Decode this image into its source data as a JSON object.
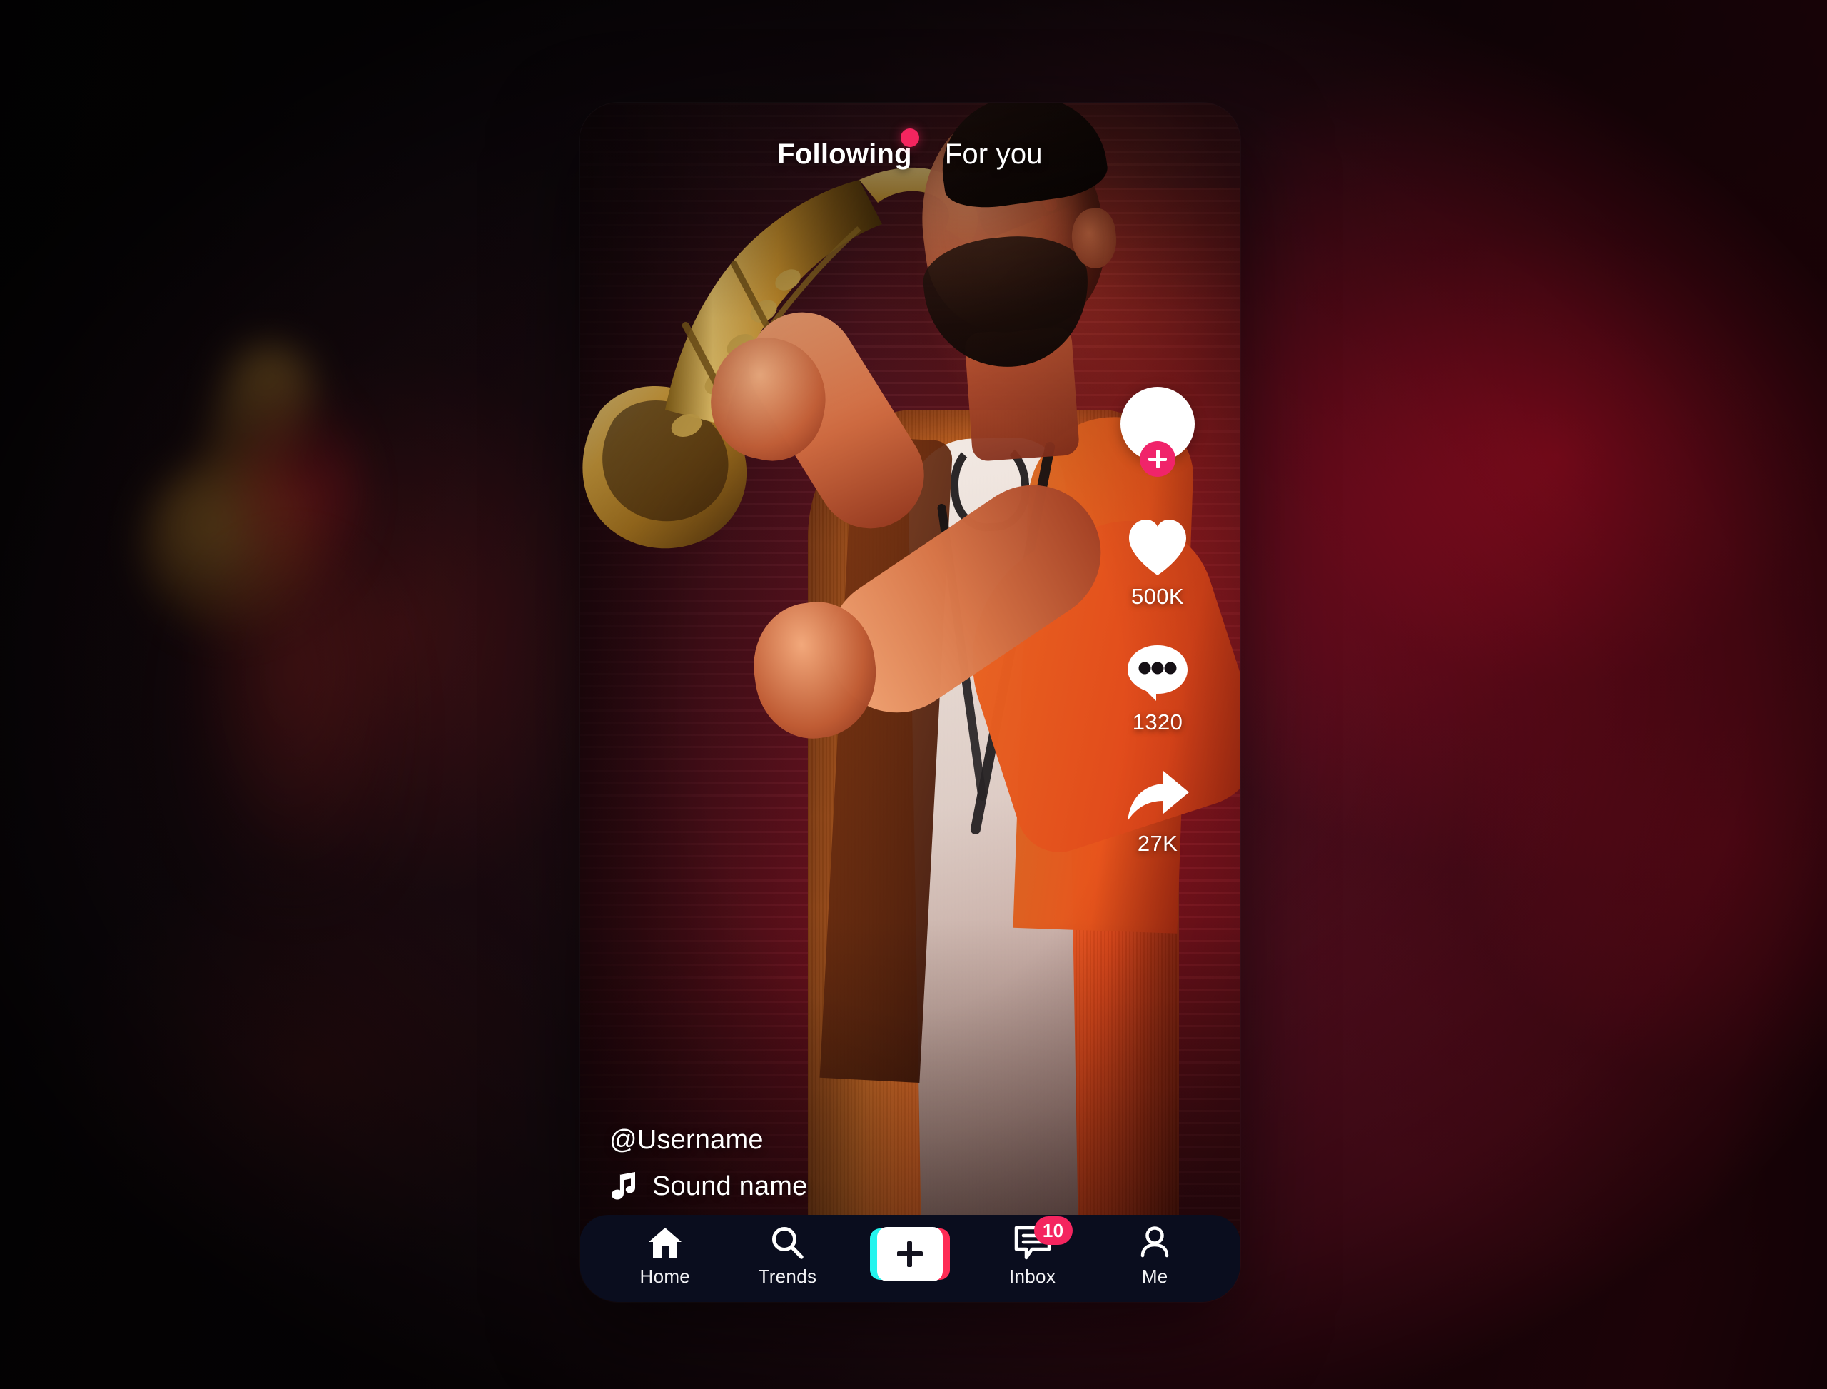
{
  "app": {
    "screen_name": "tiktok-style-video-feed"
  },
  "header": {
    "tabs": [
      {
        "label": "Following",
        "active": true
      },
      {
        "label": "For you",
        "active": false
      }
    ],
    "dot_icon": "live-dot-icon",
    "dot_color": "#f4255f"
  },
  "video": {
    "actions": [
      {
        "id": "profile",
        "icon": "avatar-with-plus-icon",
        "count": ""
      },
      {
        "id": "like",
        "icon": "heart-icon",
        "count": "500K"
      },
      {
        "id": "comment",
        "icon": "comment-bubble-icon",
        "count": "1320"
      },
      {
        "id": "share",
        "icon": "share-arrow-icon",
        "count": "27K"
      }
    ],
    "username": "@Username",
    "sound_icon": "music-note-icon",
    "sound_name": "Sound name"
  },
  "navbar": {
    "items": [
      {
        "label": "Home",
        "icon": "home-icon"
      },
      {
        "label": "Trends",
        "icon": "search-icon"
      },
      {
        "label": "",
        "icon": "create-plus-icon"
      },
      {
        "label": "Inbox",
        "icon": "inbox-message-icon",
        "badge": "10"
      },
      {
        "label": "Me",
        "icon": "person-icon"
      }
    ],
    "background_color": "#0a0d1e"
  },
  "colors": {
    "accent_pink": "#f4255f",
    "accent_cyan": "#25f4ee",
    "accent_red": "#fe2c55",
    "nav_background": "#0a0d1e",
    "text_white": "#ffffff"
  }
}
